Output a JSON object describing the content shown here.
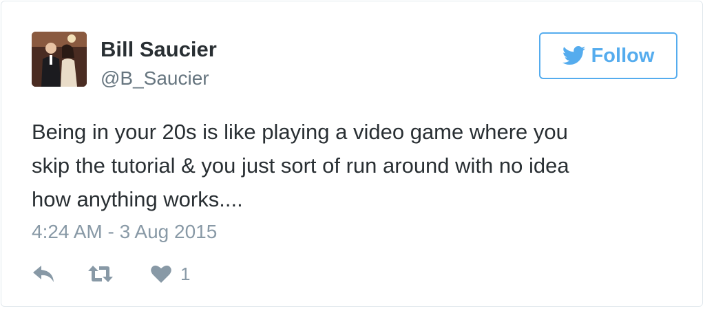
{
  "user": {
    "display_name": "Bill Saucier",
    "screen_name": "@B_Saucier",
    "avatar_icon": "profile-photo"
  },
  "follow_button": {
    "label": "Follow",
    "icon": "twitter-bird-icon",
    "color": "#55acee"
  },
  "tweet": {
    "text_lines": [
      "Being in your 20s is like playing a video game where you",
      "skip the tutorial & you just sort of run around with no idea",
      "how anything works...."
    ],
    "timestamp": "4:24 AM - 3 Aug 2015"
  },
  "actions": {
    "reply_icon": "reply-icon",
    "retweet_icon": "retweet-icon",
    "like_icon": "heart-icon",
    "like_count": "1"
  },
  "colors": {
    "text": "#292f33",
    "muted": "#66757f",
    "meta": "#8899a6",
    "accent": "#55acee",
    "border": "#e1e8ed"
  }
}
